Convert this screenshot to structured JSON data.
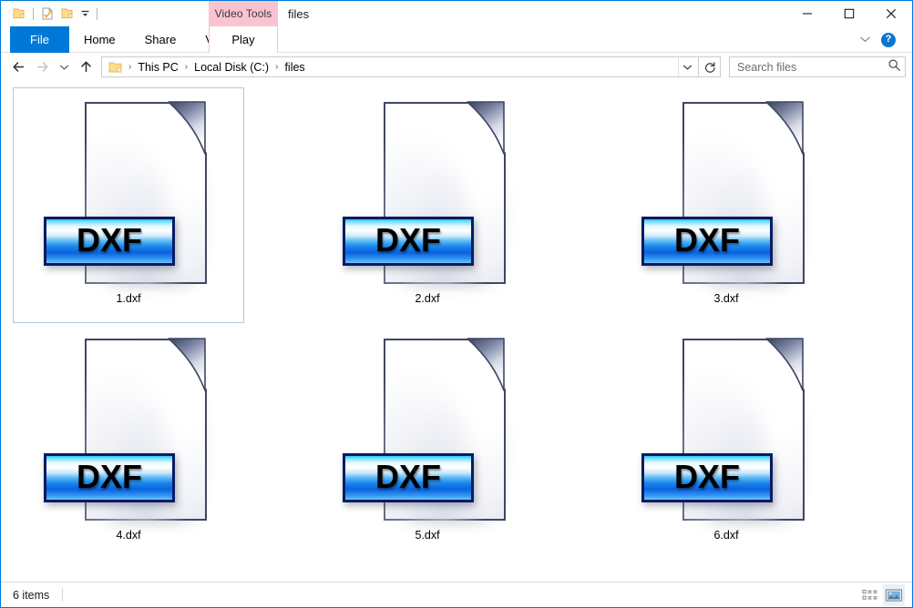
{
  "window": {
    "title": "files",
    "contextual_group": "Video Tools",
    "controls": {
      "minimize": "minimize-button",
      "maximize": "maximize-button",
      "close": "close-button"
    }
  },
  "quick_access": {
    "items": [
      {
        "name": "folder-icon",
        "label": "Folder"
      },
      {
        "name": "properties-icon",
        "label": "Properties"
      },
      {
        "name": "new-folder-icon",
        "label": "New folder"
      },
      {
        "name": "customize-chevron-icon",
        "label": "Customize Quick Access Toolbar"
      }
    ]
  },
  "ribbon": {
    "tabs": [
      {
        "label": "File",
        "active": true
      },
      {
        "label": "Home",
        "active": false
      },
      {
        "label": "Share",
        "active": false
      },
      {
        "label": "View",
        "active": false
      }
    ],
    "contextual_tab": {
      "label": "Play"
    },
    "collapse_icon": "chevron-down-icon",
    "help_icon": "help-icon",
    "help_glyph": "?"
  },
  "address_bar": {
    "back": "back-arrow-icon",
    "forward": "forward-arrow-icon",
    "recent": "recent-locations-chevron-icon",
    "up": "up-arrow-icon",
    "breadcrumbs": [
      "This PC",
      "Local Disk (C:)",
      "files"
    ],
    "separator": "›",
    "dropdown_icon": "address-dropdown-chevron-icon",
    "refresh_icon": "refresh-icon"
  },
  "search": {
    "placeholder": "Search files",
    "value": "",
    "icon": "search-icon"
  },
  "files": [
    {
      "name": "1.dxf",
      "type": "DXF",
      "badge_text": "DXF",
      "selected": true
    },
    {
      "name": "2.dxf",
      "type": "DXF",
      "badge_text": "DXF",
      "selected": false
    },
    {
      "name": "3.dxf",
      "type": "DXF",
      "badge_text": "DXF",
      "selected": false
    },
    {
      "name": "4.dxf",
      "type": "DXF",
      "badge_text": "DXF",
      "selected": false
    },
    {
      "name": "5.dxf",
      "type": "DXF",
      "badge_text": "DXF",
      "selected": false
    },
    {
      "name": "6.dxf",
      "type": "DXF",
      "badge_text": "DXF",
      "selected": false
    }
  ],
  "status_bar": {
    "item_count_text": "6 items",
    "views": [
      {
        "name": "details-view-button",
        "label": "Details view",
        "active": false
      },
      {
        "name": "large-icons-view-button",
        "label": "Large icons view",
        "active": true
      }
    ]
  },
  "colors": {
    "accent": "#0078d7",
    "contextual_pink": "#f9c3d1",
    "selection_border": "#a5cdee",
    "badge_border": "#071a63",
    "doc_border": "#3f4664"
  }
}
